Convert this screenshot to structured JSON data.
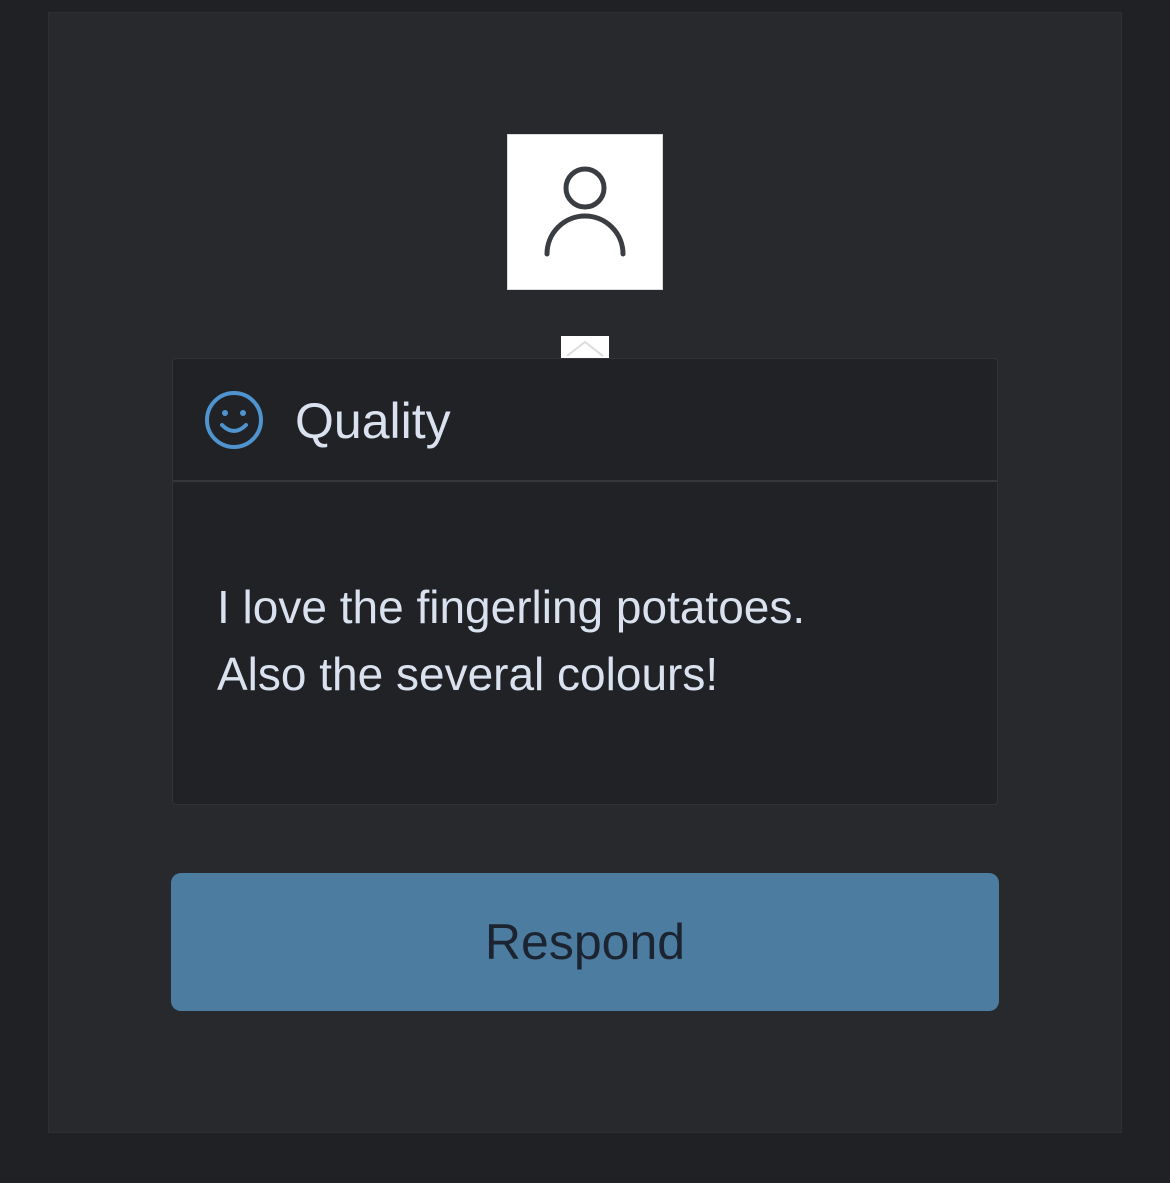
{
  "avatar": {
    "icon": "user-icon"
  },
  "feedback": {
    "category_icon": "smiley-icon",
    "category": "Quality",
    "message_lines": [
      "I love the fingerling potatoes.",
      "Also the several colours!"
    ]
  },
  "actions": {
    "respond_label": "Respond"
  },
  "colors": {
    "background": "#202124",
    "panel": "#28292c",
    "card": "#212225",
    "accent": "#4c7da1",
    "icon_blue": "#4f93cf",
    "text": "#d9e2ee"
  }
}
